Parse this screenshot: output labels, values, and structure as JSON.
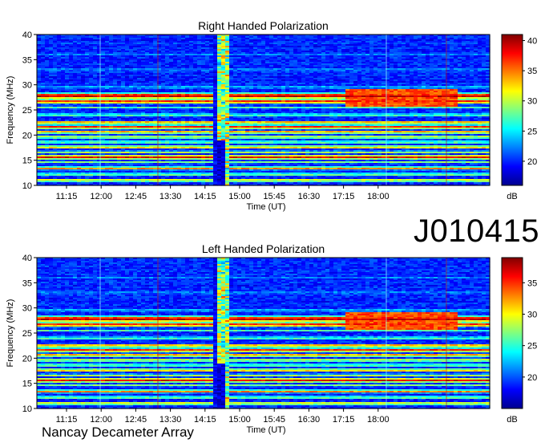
{
  "observation_id": "J010415",
  "instrument": "Nancay Decameter Array",
  "chart_data": [
    {
      "type": "heatmap",
      "title": "Right Handed Polarization",
      "xlabel": "Time (UT)",
      "ylabel": "Frequency (MHz)",
      "x_ticks": [
        "11:15",
        "12:00",
        "12:45",
        "13:30",
        "14:15",
        "15:00",
        "15:45",
        "16:30",
        "17:15",
        "18:00"
      ],
      "y_ticks": [
        10,
        15,
        20,
        25,
        30,
        35,
        40
      ],
      "ylim": [
        10,
        40
      ],
      "colorbar": {
        "label": "dB",
        "ticks": [
          20,
          25,
          30,
          35,
          40
        ],
        "range": [
          16,
          41
        ]
      },
      "time_range_minutes": [
        630,
        1115
      ],
      "burst_start_minutes": 820
    },
    {
      "type": "heatmap",
      "title": "Left Handed Polarization",
      "xlabel": "Time (UT)",
      "ylabel": "Frequency (MHz)",
      "x_ticks": [
        "11:15",
        "12:00",
        "12:45",
        "13:30",
        "14:15",
        "15:00",
        "15:45",
        "16:30",
        "17:15",
        "18:00"
      ],
      "y_ticks": [
        10,
        15,
        20,
        25,
        30,
        35,
        40
      ],
      "ylim": [
        10,
        40
      ],
      "colorbar": {
        "label": "dB",
        "ticks": [
          20,
          25,
          30,
          35
        ],
        "range": [
          15,
          39
        ]
      },
      "time_range_minutes": [
        630,
        1115
      ],
      "burst_start_minutes": 820
    }
  ]
}
